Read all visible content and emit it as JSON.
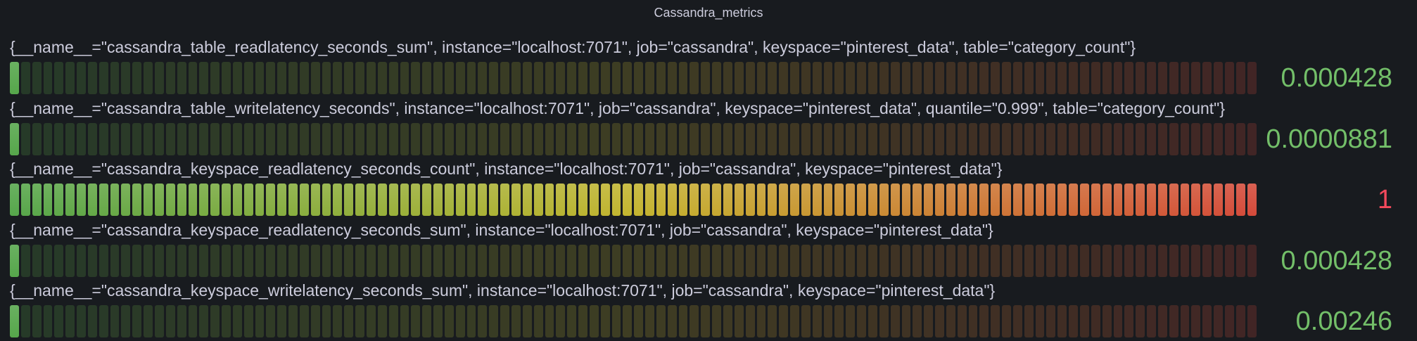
{
  "panel": {
    "title": "Cassandra_metrics"
  },
  "colors": {
    "background": "#181b1f",
    "text": "#ccccdc",
    "gradient_start": "#56a64b",
    "gradient_mid": "#c4b52f",
    "gradient_end": "#d44a3a",
    "value_low": "#73bf69",
    "value_high": "#f2495c"
  },
  "gauge": {
    "type": "bar-gauge-retro-lcd",
    "min": 0,
    "max": 1
  },
  "rows": [
    {
      "label": "{__name__=\"cassandra_table_readlatency_seconds_sum\", instance=\"localhost:7071\", job=\"cassandra\", keyspace=\"pinterest_data\", table=\"category_count\"}",
      "value_text": "0.000428",
      "value": 0.000428
    },
    {
      "label": "{__name__=\"cassandra_table_writelatency_seconds\", instance=\"localhost:7071\", job=\"cassandra\", keyspace=\"pinterest_data\", quantile=\"0.999\", table=\"category_count\"}",
      "value_text": "0.0000881",
      "value": 8.81e-05
    },
    {
      "label": "{__name__=\"cassandra_keyspace_readlatency_seconds_count\", instance=\"localhost:7071\", job=\"cassandra\", keyspace=\"pinterest_data\"}",
      "value_text": "1",
      "value": 1
    },
    {
      "label": "{__name__=\"cassandra_keyspace_readlatency_seconds_sum\", instance=\"localhost:7071\", job=\"cassandra\", keyspace=\"pinterest_data\"}",
      "value_text": "0.000428",
      "value": 0.000428
    },
    {
      "label": "{__name__=\"cassandra_keyspace_writelatency_seconds_sum\", instance=\"localhost:7071\", job=\"cassandra\", keyspace=\"pinterest_data\"}",
      "value_text": "0.00246",
      "value": 0.00246
    }
  ]
}
